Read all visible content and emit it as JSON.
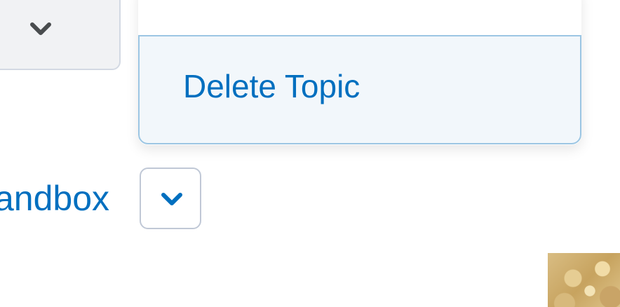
{
  "topic_menu": {
    "items": [
      {
        "label": ""
      },
      {
        "label": "Delete Topic"
      }
    ]
  },
  "forum": {
    "title_visible_fragment": "andbox"
  },
  "icons": {
    "top_button": "chevron-down-icon",
    "context_button": "chevron-down-icon",
    "thumbnail": "image-thumbnail"
  },
  "colors": {
    "link_blue": "#006fbf",
    "menu_highlight_bg": "#f2f7fb",
    "menu_highlight_border": "#9cc6e3",
    "button_grey": "#f1f2f4",
    "chevron_dark": "#494c4e"
  }
}
